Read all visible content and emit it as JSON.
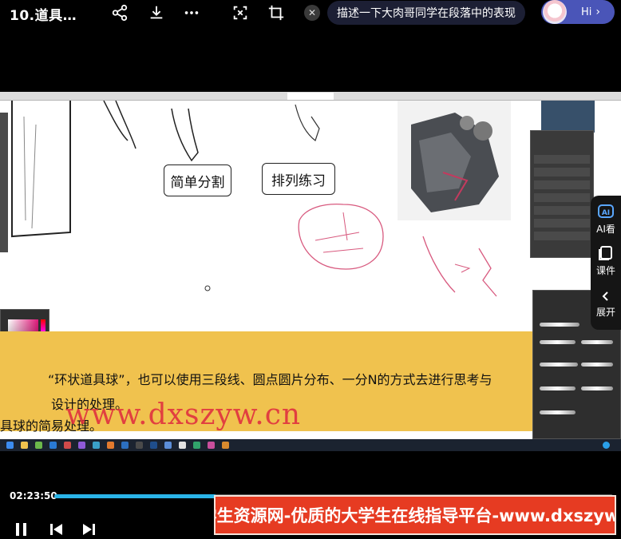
{
  "header": {
    "title": "10.道具…",
    "ask_text": "描述一下大肉哥同学在段落中的表现",
    "hi_label": "Hi",
    "hi_chevron": "›",
    "close_glyph": "✕"
  },
  "video": {
    "labels": [
      "简单分割",
      "排列练习"
    ],
    "caption_line1": "“环状道具球”，也可以使用三段线、圆点圆片分布、一分N的方式去进行思考与",
    "caption_line2": "设计的处理。",
    "caption_line3": "具球的简易处理。",
    "watermark": "www.dxszyw.cn"
  },
  "side_float": {
    "items": [
      {
        "icon": "ai-view-icon",
        "label": "AI看"
      },
      {
        "icon": "courseware-icon",
        "label": "课件"
      },
      {
        "icon": "chevron-left-icon",
        "label": "展开"
      }
    ]
  },
  "player": {
    "current_time": "02:23:50",
    "progress": 0.29
  },
  "promo": {
    "text": "大学生资源网-优质的大学生在线指导平台-www.dxszyw.cn"
  },
  "colors": {
    "accent": "#2ab4e8",
    "banner_yellow": "#f0c24e",
    "promo_red": "#e63b22",
    "watermark_red": "#e0313f"
  }
}
